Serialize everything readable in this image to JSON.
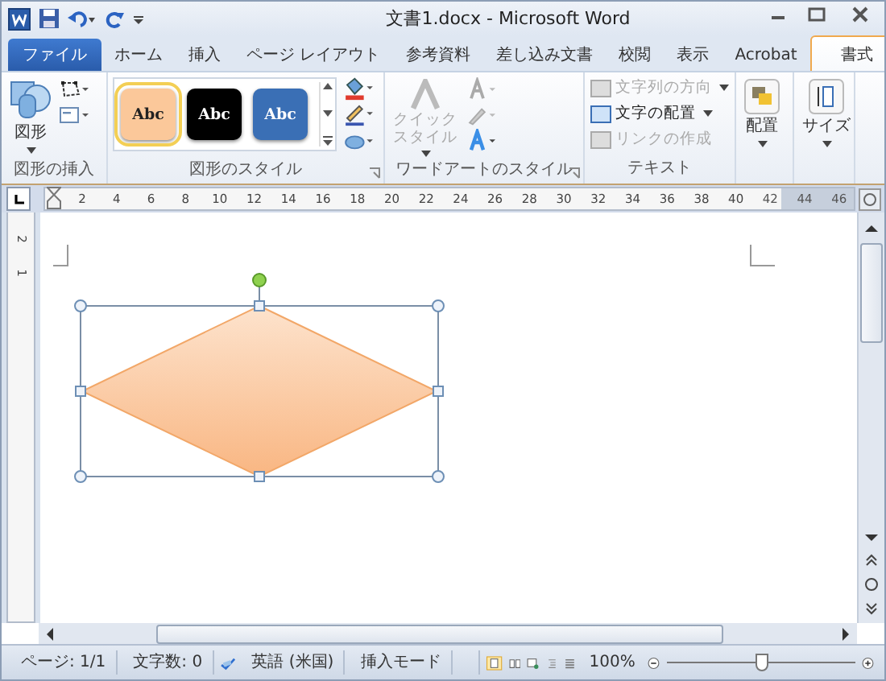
{
  "window": {
    "title": "文書1.docx - Microsoft Word"
  },
  "tabs": [
    {
      "label": "ファイル",
      "kind": "file",
      "selected": false
    },
    {
      "label": "ホーム",
      "kind": "tab",
      "selected": false
    },
    {
      "label": "挿入",
      "kind": "tab",
      "selected": false
    },
    {
      "label": "ページ レイアウト",
      "kind": "tab",
      "selected": false
    },
    {
      "label": "参考資料",
      "kind": "tab",
      "selected": false
    },
    {
      "label": "差し込み文書",
      "kind": "tab",
      "selected": false
    },
    {
      "label": "校閲",
      "kind": "tab",
      "selected": false
    },
    {
      "label": "表示",
      "kind": "tab",
      "selected": false
    },
    {
      "label": "Acrobat",
      "kind": "tab",
      "selected": false
    },
    {
      "label": "書式",
      "kind": "tab",
      "selected": true
    }
  ],
  "ribbon": {
    "insert_shapes": {
      "label": "図形の挿入",
      "shapes_button": "図形"
    },
    "shape_styles": {
      "label": "図形のスタイル",
      "styles": [
        {
          "label": "Abc",
          "selected": true,
          "color": "#fbc89a"
        },
        {
          "label": "Abc",
          "selected": false,
          "color": "#000000"
        },
        {
          "label": "Abc",
          "selected": false,
          "color": "#3a6fb5"
        }
      ]
    },
    "wordart_styles": {
      "label": "ワードアートのスタイル",
      "quick_style": [
        "クイック",
        "スタイル"
      ]
    },
    "text": {
      "label": "テキスト",
      "items": [
        {
          "label": "文字列の方向",
          "disabled": true
        },
        {
          "label": "文字の配置",
          "disabled": false
        },
        {
          "label": "リンクの作成",
          "disabled": true
        }
      ]
    },
    "arrange": {
      "label": "配置"
    },
    "size": {
      "label": "サイズ"
    }
  },
  "ruler": {
    "labels": [
      "2",
      "4",
      "6",
      "8",
      "10",
      "12",
      "14",
      "16",
      "18",
      "20",
      "22",
      "24",
      "26",
      "28",
      "30",
      "32",
      "34",
      "36",
      "38",
      "40",
      "42",
      "44",
      "46"
    ],
    "vertical_labels": [
      "2",
      "1"
    ]
  },
  "status_bar": {
    "page": "ページ: 1/1",
    "words": "文字数: 0",
    "language": "英語 (米国)",
    "mode": "挿入モード",
    "zoom": "100%",
    "zoom_slider": {
      "level": 0.5
    }
  }
}
